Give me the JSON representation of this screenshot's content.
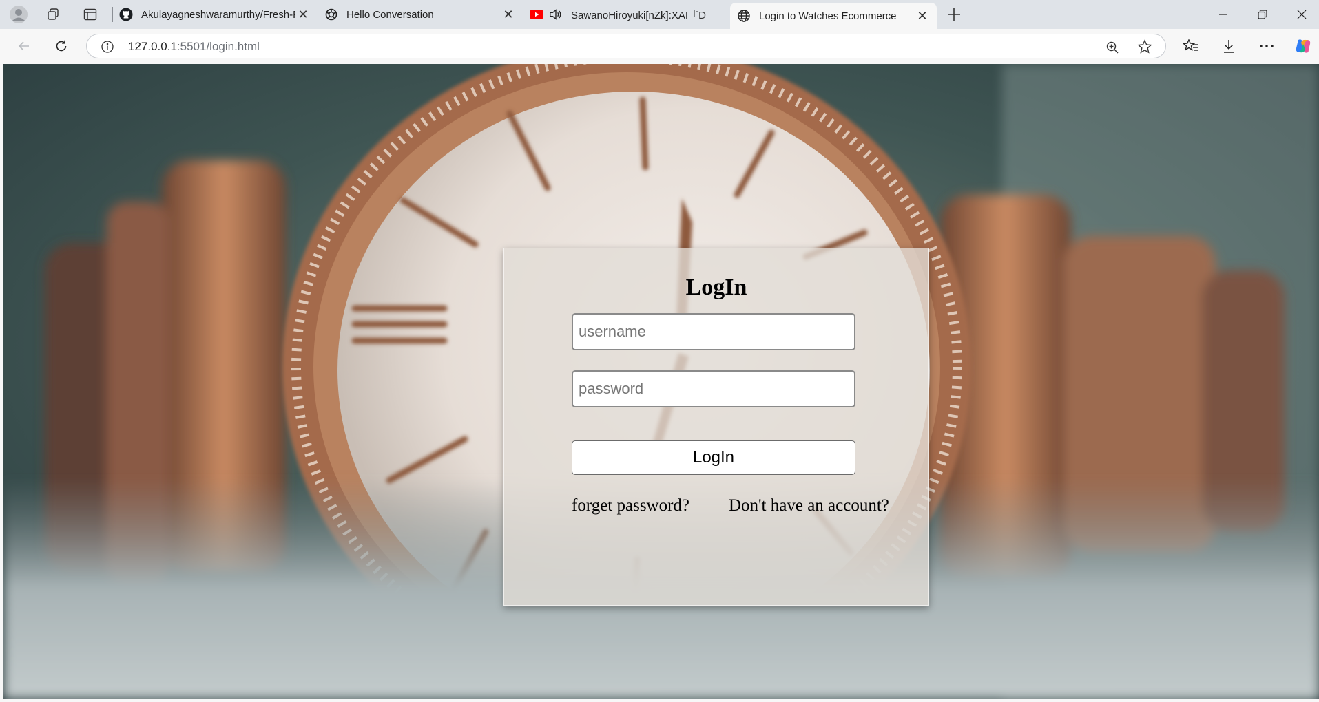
{
  "browser": {
    "tabs": [
      {
        "label": "Akulayagneshwaramurthy/Fresh-F",
        "favicon": "github-icon"
      },
      {
        "label": "Hello Conversation",
        "favicon": "openai-icon"
      },
      {
        "label": "SawanoHiroyuki[nZk]:XAI『D",
        "favicon": "youtube-icon",
        "audio": true
      },
      {
        "label": "Login to Watches Ecommerce",
        "favicon": "globe-icon",
        "active": true
      }
    ],
    "address_bar": {
      "host": "127.0.0.1",
      "port_path": ":5501/login.html"
    }
  },
  "login": {
    "title": "LogIn",
    "username_placeholder": "username",
    "password_placeholder": "password",
    "button_label": "LogIn",
    "forgot_link": "forget password?",
    "signup_link": "Don't have an account?"
  }
}
